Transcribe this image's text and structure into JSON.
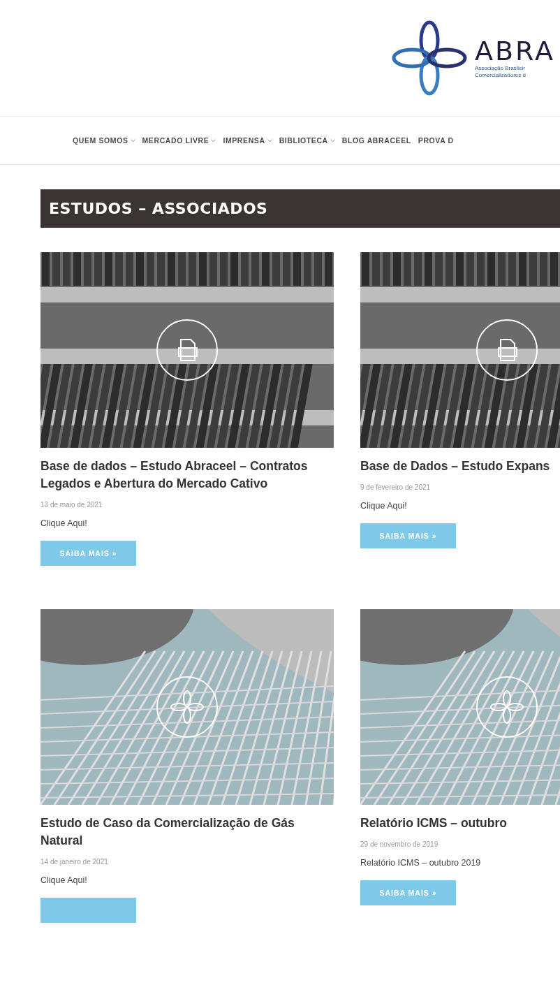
{
  "header": {
    "logo": {
      "name": "ABRA",
      "tagline_1": "Associação Brasileir",
      "tagline_2": "Comercializadores d"
    }
  },
  "nav": [
    {
      "label": "QUEM SOMOS",
      "dropdown": true
    },
    {
      "label": "MERCADO LIVRE",
      "dropdown": true
    },
    {
      "label": "IMPRENSA",
      "dropdown": true
    },
    {
      "label": "BIBLIOTECA",
      "dropdown": true
    },
    {
      "label": "BLOG ABRACEEL",
      "dropdown": false
    },
    {
      "label": "PROVA D",
      "dropdown": false
    }
  ],
  "section_title": "ESTUDOS – ASSOCIADOS",
  "cards": [
    {
      "kind": "binders",
      "title": "Base de dados – Estudo Abraceel – Contratos Legados e Abertura do Mercado Cativo",
      "date": "13 de maio de 2021",
      "excerpt": "Clique Aqui!",
      "button": {
        "label": "SAIBA MAIS »"
      }
    },
    {
      "kind": "binders",
      "title": "Base de Dados – Estudo Expans",
      "date": "9 de fevereiro de 2021",
      "excerpt": "Clique Aqui!",
      "button": {
        "label": "SAIBA MAIS »"
      }
    },
    {
      "kind": "building",
      "title": "Estudo de Caso da Comercialização de Gás Natural",
      "date": "14 de janeiro de 2021",
      "excerpt": "Clique Aqui!",
      "partial_button": true
    },
    {
      "kind": "building",
      "title": "Relatório ICMS – outubro",
      "date": "29 de novembro de 2019",
      "excerpt": "Relatório ICMS – outubro 2019",
      "button": {
        "label": "SAIBA MAIS »"
      }
    }
  ]
}
